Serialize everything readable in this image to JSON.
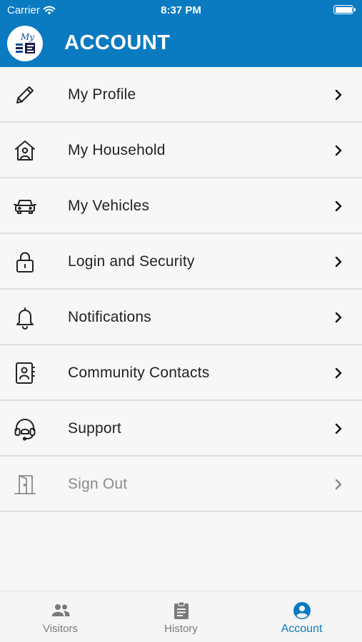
{
  "status_bar": {
    "carrier": "Carrier",
    "time": "8:37 PM",
    "battery": "battery-full-icon"
  },
  "header": {
    "title": "ACCOUNT",
    "logo_text": "My",
    "background": "#0a7ac1"
  },
  "menu": [
    {
      "label": "My Profile",
      "icon": "pencil-icon"
    },
    {
      "label": "My Household",
      "icon": "house-person-icon"
    },
    {
      "label": "My Vehicles",
      "icon": "car-icon"
    },
    {
      "label": "Login and Security",
      "icon": "lock-icon"
    },
    {
      "label": "Notifications",
      "icon": "bell-icon"
    },
    {
      "label": "Community Contacts",
      "icon": "contact-book-icon"
    },
    {
      "label": "Support",
      "icon": "headset-icon"
    },
    {
      "label": "Sign Out",
      "icon": "door-icon",
      "disabled": true
    }
  ],
  "tabs": [
    {
      "label": "Visitors",
      "icon": "people-icon",
      "active": false
    },
    {
      "label": "History",
      "icon": "clipboard-icon",
      "active": false
    },
    {
      "label": "Account",
      "icon": "account-circle-icon",
      "active": true
    }
  ],
  "colors": {
    "accent": "#0a7ac1",
    "inactive_tab": "#7a7a7a",
    "disabled_text": "#8a8a8a"
  }
}
